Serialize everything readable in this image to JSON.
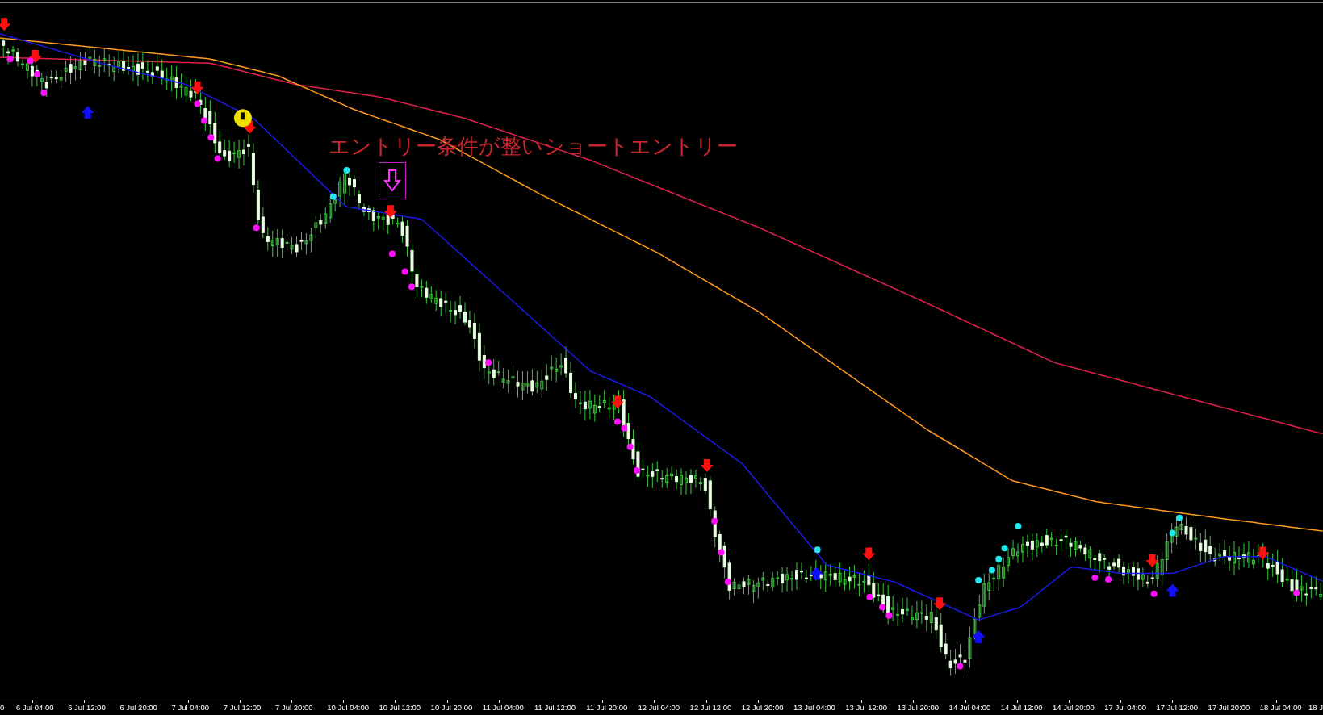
{
  "chart": {
    "annotation": "エントリー条件が整いショートエントリー",
    "time_axis_labels": [
      "0",
      "6 Jul 04:00",
      "6 Jul 12:00",
      "6 Jul 20:00",
      "7 Jul 04:00",
      "7 Jul 12:00",
      "7 Jul 20:00",
      "10 Jul 04:00",
      "10 Jul 12:00",
      "10 Jul 20:00",
      "11 Jul 04:00",
      "11 Jul 12:00",
      "11 Jul 20:00",
      "12 Jul 04:00",
      "12 Jul 12:00",
      "12 Jul 20:00",
      "13 Jul 04:00",
      "13 Jul 12:00",
      "13 Jul 20:00",
      "14 Jul 04:00",
      "14 Jul 12:00",
      "14 Jul 20:00",
      "17 Jul 04:00",
      "17 Jul 12:00",
      "17 Jul 20:00",
      "18 Jul 04:00",
      "18 J"
    ]
  }
}
